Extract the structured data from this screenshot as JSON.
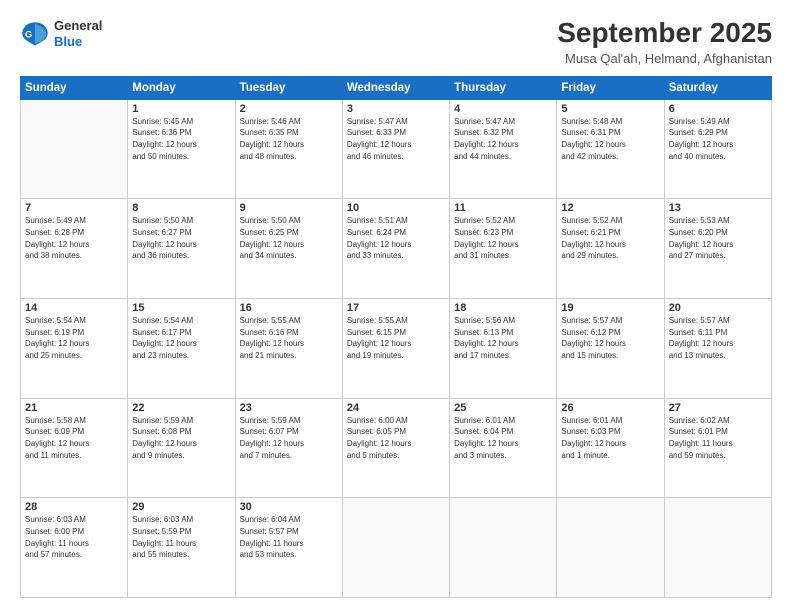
{
  "header": {
    "logo_general": "General",
    "logo_blue": "Blue",
    "title": "September 2025",
    "location": "Musa Qal'ah, Helmand, Afghanistan"
  },
  "weekdays": [
    "Sunday",
    "Monday",
    "Tuesday",
    "Wednesday",
    "Thursday",
    "Friday",
    "Saturday"
  ],
  "weeks": [
    [
      {
        "day": "",
        "info": ""
      },
      {
        "day": "1",
        "info": "Sunrise: 5:45 AM\nSunset: 6:36 PM\nDaylight: 12 hours\nand 50 minutes."
      },
      {
        "day": "2",
        "info": "Sunrise: 5:46 AM\nSunset: 6:35 PM\nDaylight: 12 hours\nand 48 minutes."
      },
      {
        "day": "3",
        "info": "Sunrise: 5:47 AM\nSunset: 6:33 PM\nDaylight: 12 hours\nand 46 minutes."
      },
      {
        "day": "4",
        "info": "Sunrise: 5:47 AM\nSunset: 6:32 PM\nDaylight: 12 hours\nand 44 minutes."
      },
      {
        "day": "5",
        "info": "Sunrise: 5:48 AM\nSunset: 6:31 PM\nDaylight: 12 hours\nand 42 minutes."
      },
      {
        "day": "6",
        "info": "Sunrise: 5:49 AM\nSunset: 6:29 PM\nDaylight: 12 hours\nand 40 minutes."
      }
    ],
    [
      {
        "day": "7",
        "info": "Sunrise: 5:49 AM\nSunset: 6:28 PM\nDaylight: 12 hours\nand 38 minutes."
      },
      {
        "day": "8",
        "info": "Sunrise: 5:50 AM\nSunset: 6:27 PM\nDaylight: 12 hours\nand 36 minutes."
      },
      {
        "day": "9",
        "info": "Sunrise: 5:50 AM\nSunset: 6:25 PM\nDaylight: 12 hours\nand 34 minutes."
      },
      {
        "day": "10",
        "info": "Sunrise: 5:51 AM\nSunset: 6:24 PM\nDaylight: 12 hours\nand 33 minutes."
      },
      {
        "day": "11",
        "info": "Sunrise: 5:52 AM\nSunset: 6:23 PM\nDaylight: 12 hours\nand 31 minutes."
      },
      {
        "day": "12",
        "info": "Sunrise: 5:52 AM\nSunset: 6:21 PM\nDaylight: 12 hours\nand 29 minutes."
      },
      {
        "day": "13",
        "info": "Sunrise: 5:53 AM\nSunset: 6:20 PM\nDaylight: 12 hours\nand 27 minutes."
      }
    ],
    [
      {
        "day": "14",
        "info": "Sunrise: 5:54 AM\nSunset: 6:19 PM\nDaylight: 12 hours\nand 25 minutes."
      },
      {
        "day": "15",
        "info": "Sunrise: 5:54 AM\nSunset: 6:17 PM\nDaylight: 12 hours\nand 23 minutes."
      },
      {
        "day": "16",
        "info": "Sunrise: 5:55 AM\nSunset: 6:16 PM\nDaylight: 12 hours\nand 21 minutes."
      },
      {
        "day": "17",
        "info": "Sunrise: 5:55 AM\nSunset: 6:15 PM\nDaylight: 12 hours\nand 19 minutes."
      },
      {
        "day": "18",
        "info": "Sunrise: 5:56 AM\nSunset: 6:13 PM\nDaylight: 12 hours\nand 17 minutes."
      },
      {
        "day": "19",
        "info": "Sunrise: 5:57 AM\nSunset: 6:12 PM\nDaylight: 12 hours\nand 15 minutes."
      },
      {
        "day": "20",
        "info": "Sunrise: 5:57 AM\nSunset: 6:11 PM\nDaylight: 12 hours\nand 13 minutes."
      }
    ],
    [
      {
        "day": "21",
        "info": "Sunrise: 5:58 AM\nSunset: 6:09 PM\nDaylight: 12 hours\nand 11 minutes."
      },
      {
        "day": "22",
        "info": "Sunrise: 5:59 AM\nSunset: 6:08 PM\nDaylight: 12 hours\nand 9 minutes."
      },
      {
        "day": "23",
        "info": "Sunrise: 5:59 AM\nSunset: 6:07 PM\nDaylight: 12 hours\nand 7 minutes."
      },
      {
        "day": "24",
        "info": "Sunrise: 6:00 AM\nSunset: 6:05 PM\nDaylight: 12 hours\nand 5 minutes."
      },
      {
        "day": "25",
        "info": "Sunrise: 6:01 AM\nSunset: 6:04 PM\nDaylight: 12 hours\nand 3 minutes."
      },
      {
        "day": "26",
        "info": "Sunrise: 6:01 AM\nSunset: 6:03 PM\nDaylight: 12 hours\nand 1 minute."
      },
      {
        "day": "27",
        "info": "Sunrise: 6:02 AM\nSunset: 6:01 PM\nDaylight: 11 hours\nand 59 minutes."
      }
    ],
    [
      {
        "day": "28",
        "info": "Sunrise: 6:03 AM\nSunset: 6:00 PM\nDaylight: 11 hours\nand 57 minutes."
      },
      {
        "day": "29",
        "info": "Sunrise: 6:03 AM\nSunset: 5:59 PM\nDaylight: 11 hours\nand 55 minutes."
      },
      {
        "day": "30",
        "info": "Sunrise: 6:04 AM\nSunset: 5:57 PM\nDaylight: 11 hours\nand 53 minutes."
      },
      {
        "day": "",
        "info": ""
      },
      {
        "day": "",
        "info": ""
      },
      {
        "day": "",
        "info": ""
      },
      {
        "day": "",
        "info": ""
      }
    ]
  ]
}
